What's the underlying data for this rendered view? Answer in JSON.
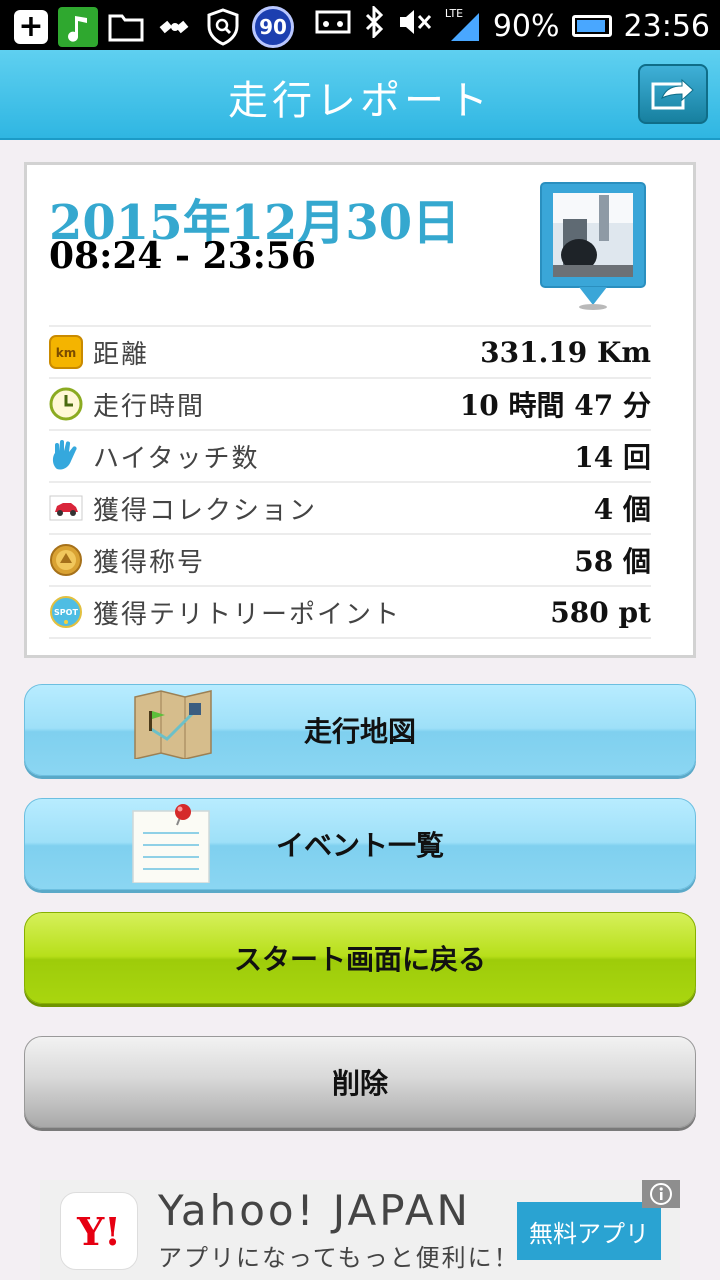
{
  "status_bar": {
    "badge_number": "90",
    "network": "LTE",
    "battery": "90%",
    "time": "23:56"
  },
  "header": {
    "title": "走行レポート",
    "share_icon": "share-arrow-icon"
  },
  "report": {
    "date": "2015年12月30日",
    "time_range": "08:24 - 23:56",
    "rows": [
      {
        "icon": "km-icon",
        "label": "距離",
        "value": "331.19 Km"
      },
      {
        "icon": "clock-icon",
        "label": "走行時間",
        "value": "10 時間 47 分"
      },
      {
        "icon": "high-five-icon",
        "label": "ハイタッチ数",
        "value": "14 回"
      },
      {
        "icon": "car-icon",
        "label": "獲得コレクション",
        "value": "4 個"
      },
      {
        "icon": "medal-icon",
        "label": "獲得称号",
        "value": "58 個"
      },
      {
        "icon": "spot-icon",
        "label": "獲得テリトリーポイント",
        "value": "580 pt"
      }
    ]
  },
  "buttons": {
    "map": "走行地図",
    "events": "イベント一覧",
    "back_to_start": "スタート画面に戻る",
    "delete": "削除"
  },
  "ad": {
    "logo": "Y!",
    "title": "Yahoo! JAPAN",
    "subtitle": "アプリになってもっと便利に！",
    "cta": "無料アプリ"
  },
  "colors": {
    "header": "#2fb6e2",
    "date": "#35a8cf",
    "green_button": "#b7df1a",
    "ad_button": "#2aa3d2"
  }
}
